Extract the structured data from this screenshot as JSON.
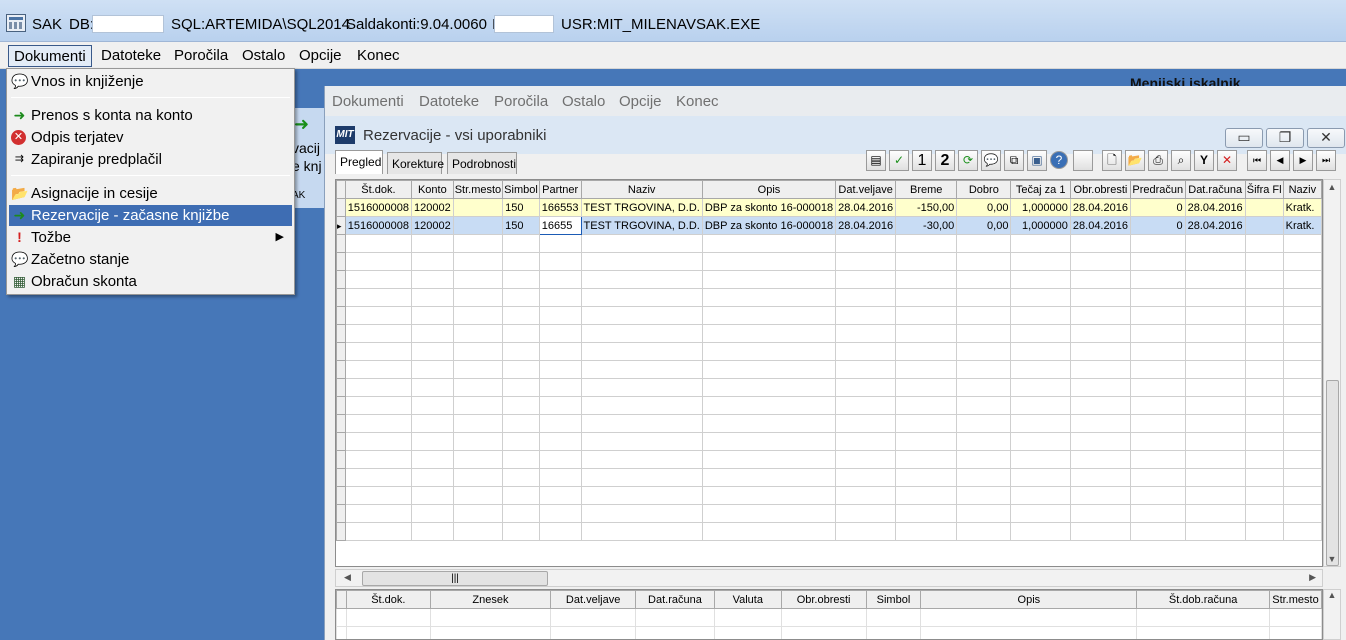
{
  "titlebar": {
    "app": "SAK",
    "db_label": "DB:",
    "sql": "SQL:ARTEMIDA\\SQL2014",
    "saldakonti": "Saldakonti:9.04.0060",
    "mask2_prefix": "I",
    "usr": "USR:MIT_MILENA",
    "exe": "VSAK.EXE"
  },
  "menubar": {
    "items": [
      "Dokumenti",
      "Datoteke",
      "Poročila",
      "Ostalo",
      "Opcije",
      "Konec"
    ]
  },
  "iskalnik": "Menijski iskalnik",
  "bgpanel": {
    "t1": "vacij",
    "t2": "e knj",
    "t3": "AK"
  },
  "dropdown": {
    "vnos": "Vnos in knjiženje",
    "prenos": "Prenos s konta na konto",
    "odpis": "Odpis terjatev",
    "zapiranje": "Zapiranje predplačil",
    "asignacije": "Asignacije in cesije",
    "rezervacije": "Rezervacije - začasne knjižbe",
    "tozbe": "Tožbe",
    "zacetno": "Začetno stanje",
    "obracun": "Obračun skonta"
  },
  "child": {
    "menu": [
      "Dokumenti",
      "Datoteke",
      "Poročila",
      "Ostalo",
      "Opcije",
      "Konec"
    ],
    "logo": "MIT",
    "title": "Rezervacije - vsi uporabniki",
    "tabs": [
      "Pregled",
      "Korekture",
      "Podrobnosti"
    ],
    "toolbar_digits": [
      "1",
      "2"
    ]
  },
  "grid": {
    "columns": [
      "Št.dok.",
      "Konto",
      "Str.mesto",
      "Simbol",
      "Partner",
      "Naziv",
      "Opis",
      "Dat.veljave",
      "Breme",
      "Dobro",
      "Tečaj za 1",
      "Obr.obresti",
      "Predračun",
      "Dat.računa",
      "Šifra Fl",
      "Naziv"
    ],
    "rows": [
      [
        "1516000008",
        "120002",
        "",
        "150",
        "166553",
        "TEST TRGOVINA, D.D.",
        "DBP za skonto 16-000018",
        "28.04.2016",
        "-150,00",
        "0,00",
        "1,000000",
        "28.04.2016",
        "0",
        "28.04.2016",
        "",
        "Kratk."
      ],
      [
        "1516000008",
        "120002",
        "",
        "150",
        "16655",
        "TEST TRGOVINA, D.D.",
        "DBP za skonto 16-000018",
        "28.04.2016",
        "-30,00",
        "0,00",
        "1,000000",
        "28.04.2016",
        "0",
        "28.04.2016",
        "",
        "Kratk."
      ]
    ]
  },
  "grid2": {
    "columns": [
      "Št.dok.",
      "Znesek",
      "Dat.veljave",
      "Dat.računa",
      "Valuta",
      "Obr.obresti",
      "Simbol",
      "Opis",
      "Št.dob.računa",
      "Str.mesto"
    ]
  },
  "icons": {
    "check": "✓",
    "close": "✕",
    "first": "⏮",
    "prev": "◀",
    "next": "▶",
    "last": "⏭",
    "filter": "Y",
    "help": "?"
  }
}
